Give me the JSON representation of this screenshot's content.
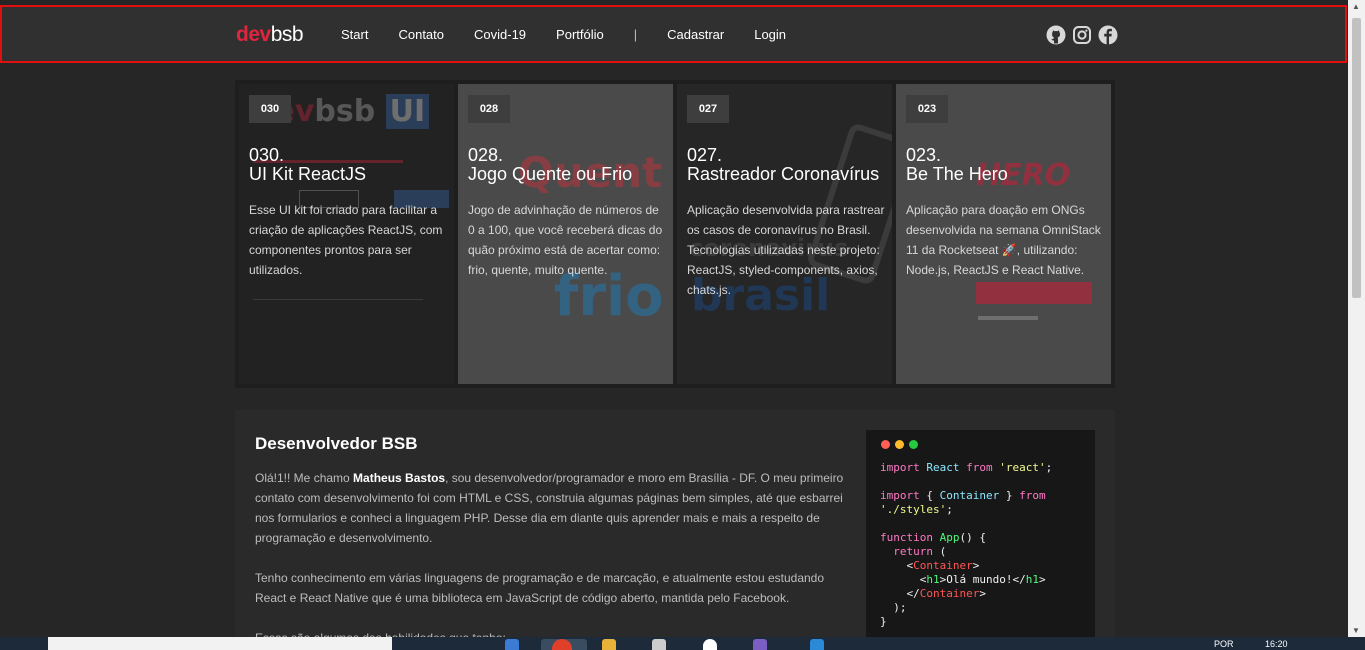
{
  "header": {
    "logo_dev": "dev",
    "logo_bsb": "bsb",
    "nav": {
      "start": "Start",
      "contato": "Contato",
      "covid": "Covid-19",
      "portfolio": "Portfólio",
      "separator": "|",
      "cadastrar": "Cadastrar",
      "login": "Login"
    },
    "social": [
      "github-icon",
      "instagram-icon",
      "facebook-icon"
    ]
  },
  "cards": [
    {
      "badge": "030",
      "number": "030.",
      "title": "UI Kit ReactJS",
      "description": "Esse UI kit foi criado para facilitar a criação de aplicações ReactJS, com componentes prontos para ser utilizados."
    },
    {
      "badge": "028",
      "number": "028.",
      "title": "Jogo Quente ou Frio",
      "description": "Jogo de advinhação de números de 0 a 100, que você receberá dicas do quão próximo está de acertar como: frio, quente, muito quente."
    },
    {
      "badge": "027",
      "number": "027.",
      "title": "Rastreador Coronavírus",
      "description": "Aplicação desenvolvida para rastrear os casos de coronavírus no Brasil. Tecnologias utilizadas neste projeto: ReactJS, styled-components, axios, chats.js."
    },
    {
      "badge": "023",
      "number": "023.",
      "title": "Be The Hero",
      "description": "Aplicação para doação em ONGs desenvolvida na semana OmniStack 11 da Rocketseat 🚀, utilizando: Node.js, ReactJS e React Native."
    }
  ],
  "about": {
    "title": "Desenvolvedor BSB",
    "p1_before": "Olá!1!! Me chamo ",
    "p1_name": "Matheus Bastos",
    "p1_after": ", sou desenvolvedor/programador e moro em Brasília - DF. O meu primeiro contato com desenvolvimento foi com HTML e CSS, construia algumas páginas bem simples, até que esbarrei nos formularios e conheci a linguagem PHP. Desse dia em diante quis aprender mais e mais a respeito de programação e desenvolvimento.",
    "p2": "Tenho conhecimento em várias linguagens de programação e de marcação, e atualmente estou estudando React e React Native que é uma biblioteca em JavaScript de código aberto, mantida pelo Facebook.",
    "p3": "Essas são algumas das habilidades que tenho:"
  },
  "code_window": {
    "dot_colors": [
      "#ff5f56",
      "#ffbd2e",
      "#27c93f"
    ]
  },
  "taskbar": {
    "lang": "POR",
    "time": "16:20"
  },
  "colors": {
    "accent": "#e0263f",
    "header_bg": "#303030",
    "page_bg": "#262626"
  }
}
